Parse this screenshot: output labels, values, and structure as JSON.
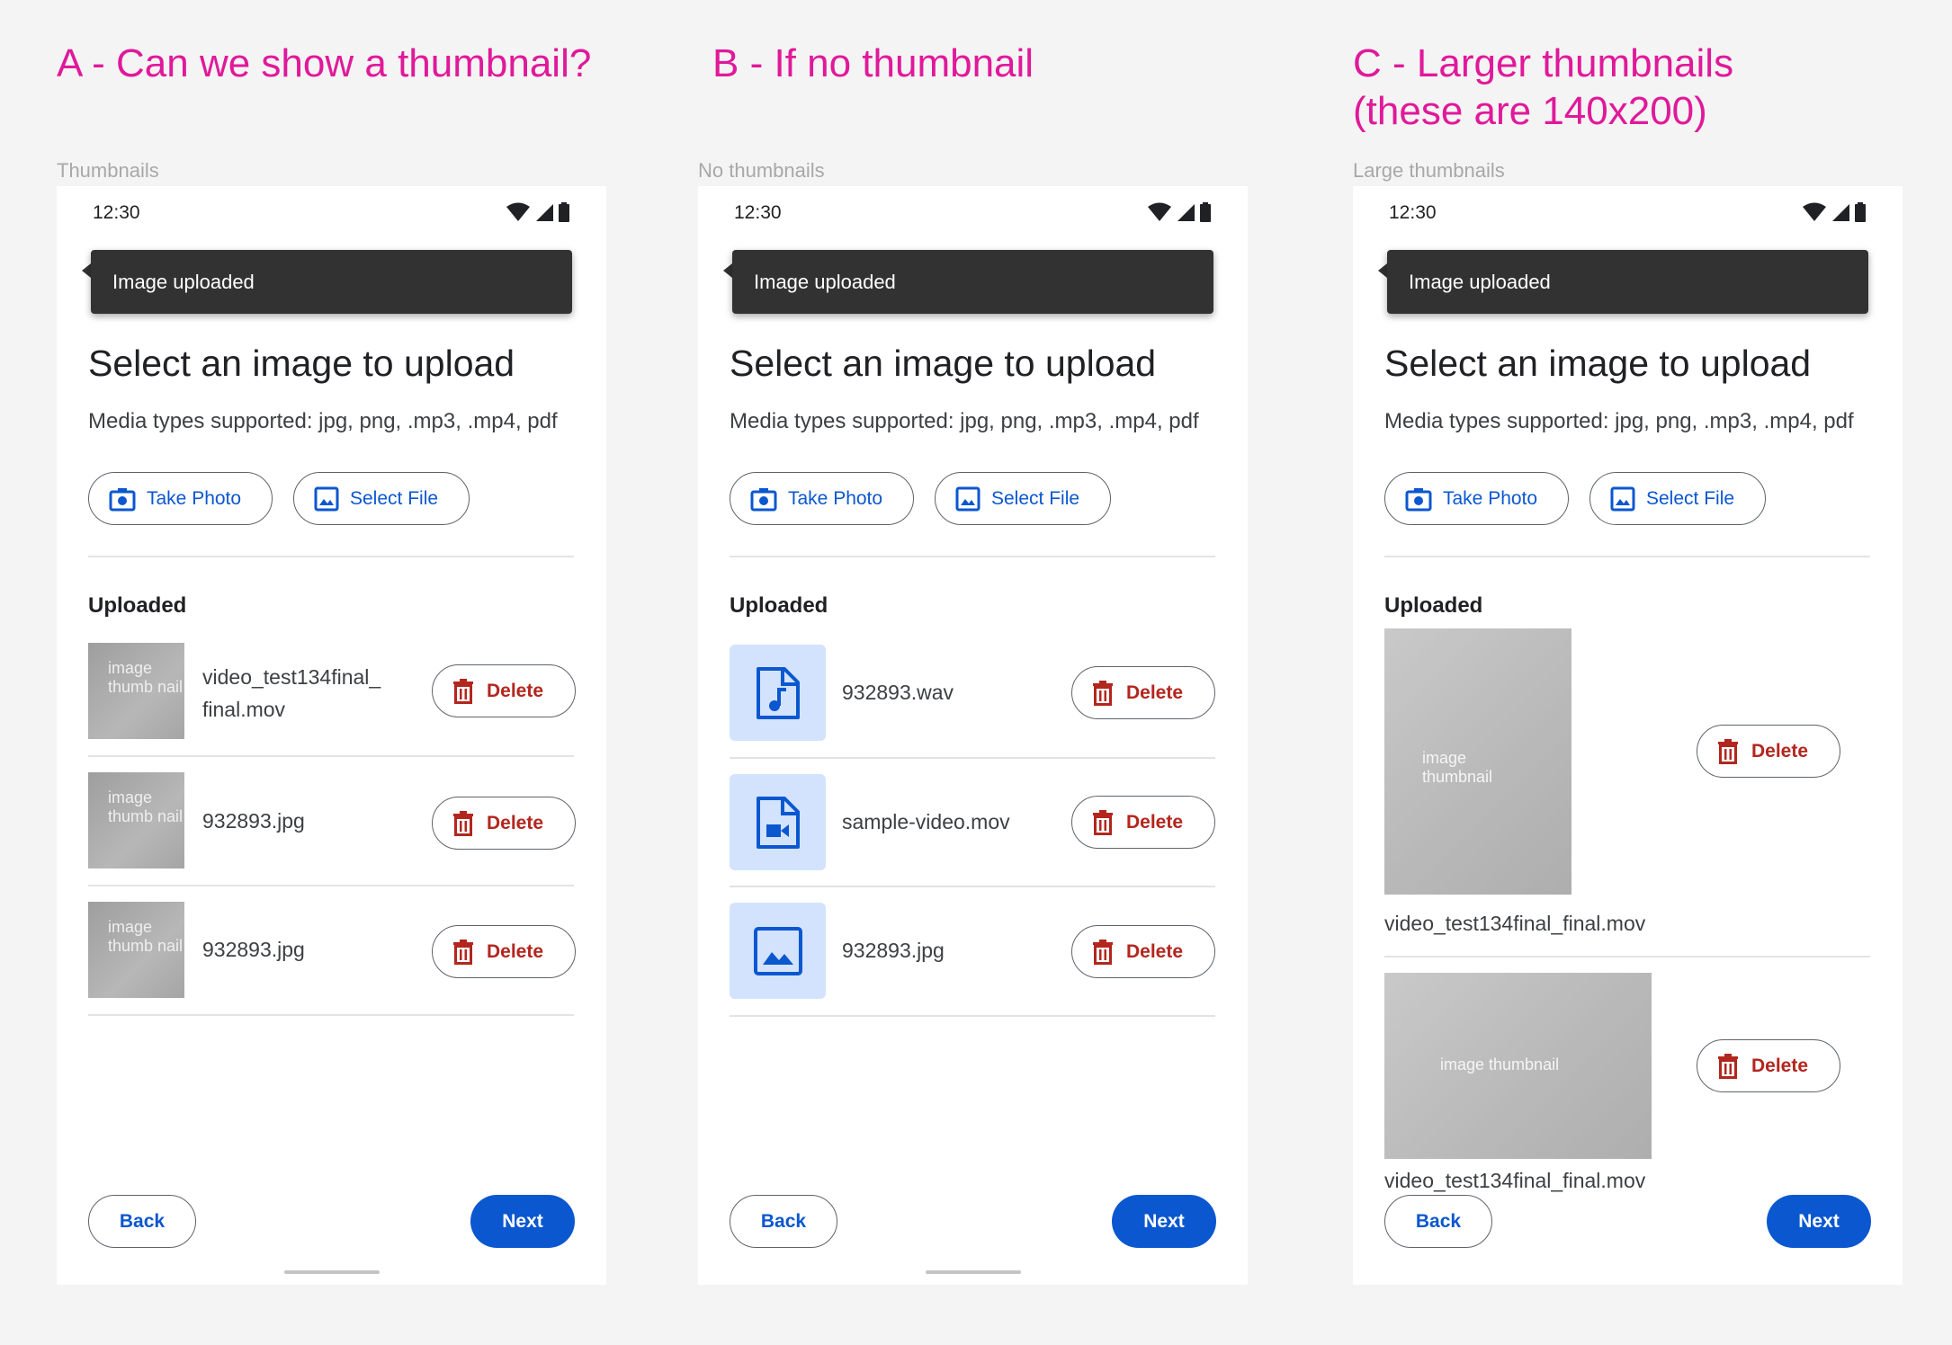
{
  "colors": {
    "heading": "#e0199a",
    "primary": "#0b57d0",
    "danger": "#b3261e",
    "snackbar": "#323232",
    "icon_tile": "#d3e3fd"
  },
  "headings": {
    "a": "A - Can we show a thumbnail?",
    "b": "B - If no thumbnail",
    "c_line1": "C - Larger thumbnails",
    "c_line2": "(these are 140x200)"
  },
  "frames": [
    {
      "label": "Thumbnails",
      "time": "12:30",
      "snackbar": "Image uploaded",
      "title": "Select an image to upload",
      "subtitle": "Media types supported: jpg, png, .mp3, .mp4, pdf",
      "take_photo": "Take Photo",
      "select_file": "Select File",
      "section": "Uploaded",
      "items": [
        {
          "thumb": "image thumb nail",
          "name_line1": "video_test134final_",
          "name_line2": "final.mov",
          "delete": "Delete"
        },
        {
          "thumb": "image thumb nail",
          "name": "932893.jpg",
          "delete": "Delete"
        },
        {
          "thumb": "image thumb nail",
          "name": "932893.jpg",
          "delete": "Delete"
        }
      ],
      "back": "Back",
      "next": "Next"
    },
    {
      "label": "No thumbnails",
      "time": "12:30",
      "snackbar": "Image uploaded",
      "title": "Select an image to upload",
      "subtitle": "Media types supported: jpg, png, .mp3, .mp4, pdf",
      "take_photo": "Take Photo",
      "select_file": "Select File",
      "section": "Uploaded",
      "items": [
        {
          "icon": "audio-file-icon",
          "name": "932893.wav",
          "delete": "Delete"
        },
        {
          "icon": "video-file-icon",
          "name": "sample-video.mov",
          "delete": "Delete"
        },
        {
          "icon": "image-icon",
          "name": "932893.jpg",
          "delete": "Delete"
        }
      ],
      "back": "Back",
      "next": "Next"
    },
    {
      "label": "Large thumbnails",
      "time": "12:30",
      "snackbar": "Image uploaded",
      "title": "Select an image to upload",
      "subtitle": "Media types supported: jpg, png, .mp3, .mp4, pdf",
      "take_photo": "Take Photo",
      "select_file": "Select File",
      "section": "Uploaded",
      "items": [
        {
          "thumb": "image thumbnail",
          "name": "video_test134final_final.mov",
          "delete": "Delete"
        },
        {
          "thumb": "image thumbnail",
          "name": "video_test134final_final.mov",
          "delete": "Delete"
        }
      ],
      "back": "Back",
      "next": "Next"
    }
  ]
}
